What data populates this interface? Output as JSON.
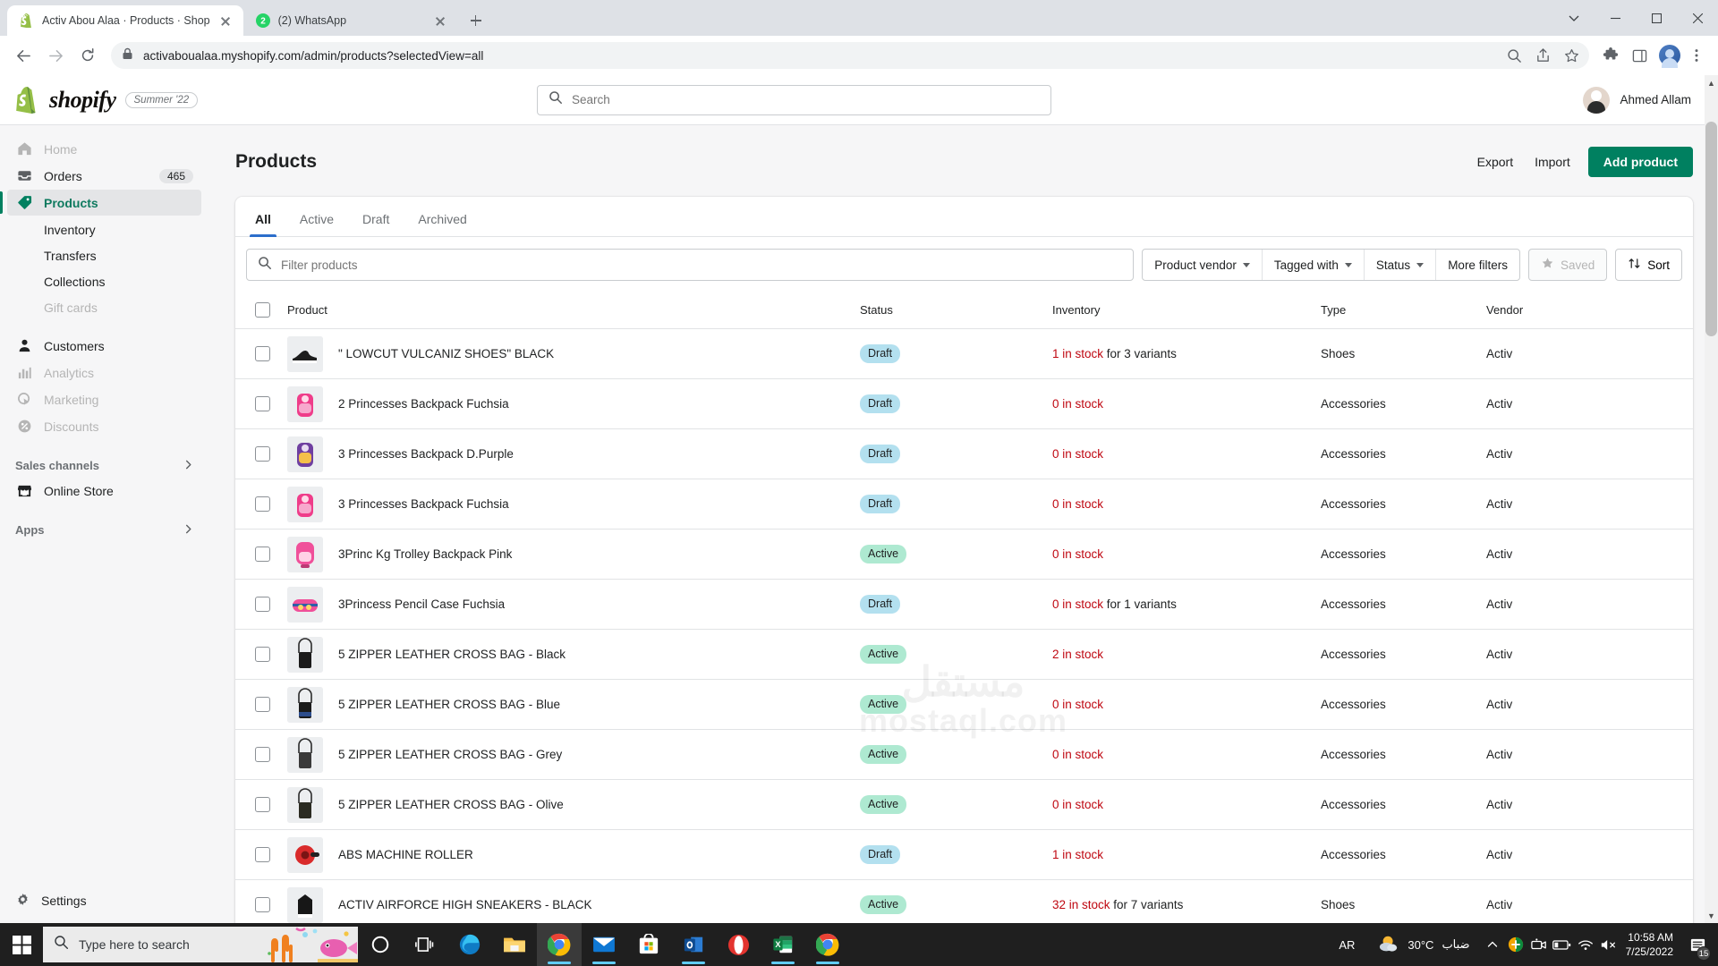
{
  "browser": {
    "tabs": [
      {
        "title": "Activ Abou Alaa · Products · Shop",
        "favicon": "shopify-icon",
        "active": true
      },
      {
        "title": "(2) WhatsApp",
        "favicon": "whatsapp-icon",
        "active": false
      }
    ],
    "url": "activaboualaa.myshopify.com/admin/products?selectedView=all",
    "nav": {
      "back": "back-icon",
      "forward": "forward-icon",
      "reload": "reload-icon"
    },
    "window": {
      "minimize": "minimize-icon",
      "maximize": "maximize-icon",
      "close": "close-icon",
      "chevron": "chevron-down-icon"
    }
  },
  "shopify": {
    "logo_text": "shopify",
    "season_badge": "Summer '22",
    "search_placeholder": "Search",
    "user": "Ahmed Allam"
  },
  "sidebar": {
    "items": [
      {
        "label": "Home",
        "icon": "home-icon",
        "state": "dim"
      },
      {
        "label": "Orders",
        "icon": "orders-icon",
        "state": "normal",
        "badge": "465"
      },
      {
        "label": "Products",
        "icon": "products-tag-icon",
        "state": "selected"
      },
      {
        "label": "Inventory",
        "icon": "",
        "state": "sub"
      },
      {
        "label": "Transfers",
        "icon": "",
        "state": "sub"
      },
      {
        "label": "Collections",
        "icon": "",
        "state": "sub"
      },
      {
        "label": "Gift cards",
        "icon": "",
        "state": "sub-dim"
      },
      {
        "label": "Customers",
        "icon": "customers-icon",
        "state": "normal"
      },
      {
        "label": "Analytics",
        "icon": "analytics-icon",
        "state": "dim"
      },
      {
        "label": "Marketing",
        "icon": "marketing-icon",
        "state": "dim"
      },
      {
        "label": "Discounts",
        "icon": "discounts-icon",
        "state": "dim"
      }
    ],
    "sales_channels_label": "Sales channels",
    "online_store_label": "Online Store",
    "apps_label": "Apps",
    "settings_label": "Settings"
  },
  "page": {
    "title": "Products",
    "export_label": "Export",
    "import_label": "Import",
    "add_product_label": "Add product"
  },
  "tabs": [
    {
      "label": "All",
      "active": true
    },
    {
      "label": "Active",
      "active": false
    },
    {
      "label": "Draft",
      "active": false
    },
    {
      "label": "Archived",
      "active": false
    }
  ],
  "filters": {
    "search_placeholder": "Filter products",
    "product_vendor": "Product vendor",
    "tagged_with": "Tagged with",
    "status": "Status",
    "more_filters": "More filters",
    "saved": "Saved",
    "sort": "Sort"
  },
  "table": {
    "columns": [
      "Product",
      "Status",
      "Inventory",
      "Type",
      "Vendor"
    ],
    "rows": [
      {
        "product": "\" LOWCUT VULCANIZ SHOES\" BLACK",
        "status": "Draft",
        "inventory_count": "1 in stock",
        "inventory_sub": " for 3 variants",
        "type": "Shoes",
        "vendor": "Activ",
        "thumb": "black-shoe"
      },
      {
        "product": "2 Princesses Backpack Fuchsia",
        "status": "Draft",
        "inventory_count": "0 in stock",
        "inventory_sub": "",
        "type": "Accessories",
        "vendor": "Activ",
        "thumb": "pink-backpack"
      },
      {
        "product": "3 Princesses Backpack D.Purple",
        "status": "Draft",
        "inventory_count": "0 in stock",
        "inventory_sub": "",
        "type": "Accessories",
        "vendor": "Activ",
        "thumb": "purple-backpack"
      },
      {
        "product": "3 Princesses Backpack Fuchsia",
        "status": "Draft",
        "inventory_count": "0 in stock",
        "inventory_sub": "",
        "type": "Accessories",
        "vendor": "Activ",
        "thumb": "pink-backpack"
      },
      {
        "product": "3Princ Kg Trolley Backpack Pink",
        "status": "Active",
        "inventory_count": "0 in stock",
        "inventory_sub": "",
        "type": "Accessories",
        "vendor": "Activ",
        "thumb": "pink-trolley"
      },
      {
        "product": "3Princess Pencil Case Fuchsia",
        "status": "Draft",
        "inventory_count": "0 in stock",
        "inventory_sub": " for 1 variants",
        "type": "Accessories",
        "vendor": "Activ",
        "thumb": "pencil-case"
      },
      {
        "product": "5 ZIPPER LEATHER CROSS BAG - Black",
        "status": "Active",
        "inventory_count": "2 in stock",
        "inventory_sub": "",
        "type": "Accessories",
        "vendor": "Activ",
        "thumb": "black-bag"
      },
      {
        "product": "5 ZIPPER LEATHER CROSS BAG - Blue",
        "status": "Active",
        "inventory_count": "0 in stock",
        "inventory_sub": "",
        "type": "Accessories",
        "vendor": "Activ",
        "thumb": "blue-bag"
      },
      {
        "product": "5 ZIPPER LEATHER CROSS BAG - Grey",
        "status": "Active",
        "inventory_count": "0 in stock",
        "inventory_sub": "",
        "type": "Accessories",
        "vendor": "Activ",
        "thumb": "grey-bag"
      },
      {
        "product": "5 ZIPPER LEATHER CROSS BAG - Olive",
        "status": "Active",
        "inventory_count": "0 in stock",
        "inventory_sub": "",
        "type": "Accessories",
        "vendor": "Activ",
        "thumb": "olive-bag"
      },
      {
        "product": "ABS MACHINE ROLLER",
        "status": "Draft",
        "inventory_count": "1 in stock",
        "inventory_sub": "",
        "type": "Accessories",
        "vendor": "Activ",
        "thumb": "red-roller"
      },
      {
        "product": "ACTIV AIRFORCE HIGH SNEAKERS - BLACK",
        "status": "Active",
        "inventory_count": "32 in stock",
        "inventory_sub": " for 7 variants",
        "type": "Shoes",
        "vendor": "Activ",
        "thumb": "black-sneaker"
      }
    ]
  },
  "watermark": {
    "arabic": "مستقل",
    "latin": "mostaql.com"
  },
  "taskbar": {
    "search_placeholder": "Type here to search",
    "apps": [
      "cortana-icon",
      "task-view-icon",
      "edge-icon",
      "file-explorer-icon",
      "chrome-icon",
      "mail-icon",
      "microsoft-store-icon",
      "outlook-icon",
      "opera-icon",
      "excel-icon",
      "chrome-icon"
    ],
    "language": "AR",
    "weather_temp": "30°C",
    "weather_desc": "ضباب",
    "time": "10:58 AM",
    "date": "7/25/2022",
    "notification_count": "15"
  },
  "colors": {
    "shopify_green": "#008060",
    "accent_blue": "#2c6ecb",
    "draft_badge": "#b3e0ef",
    "active_badge": "#aee9d1",
    "inventory_red": "#bf0711"
  }
}
